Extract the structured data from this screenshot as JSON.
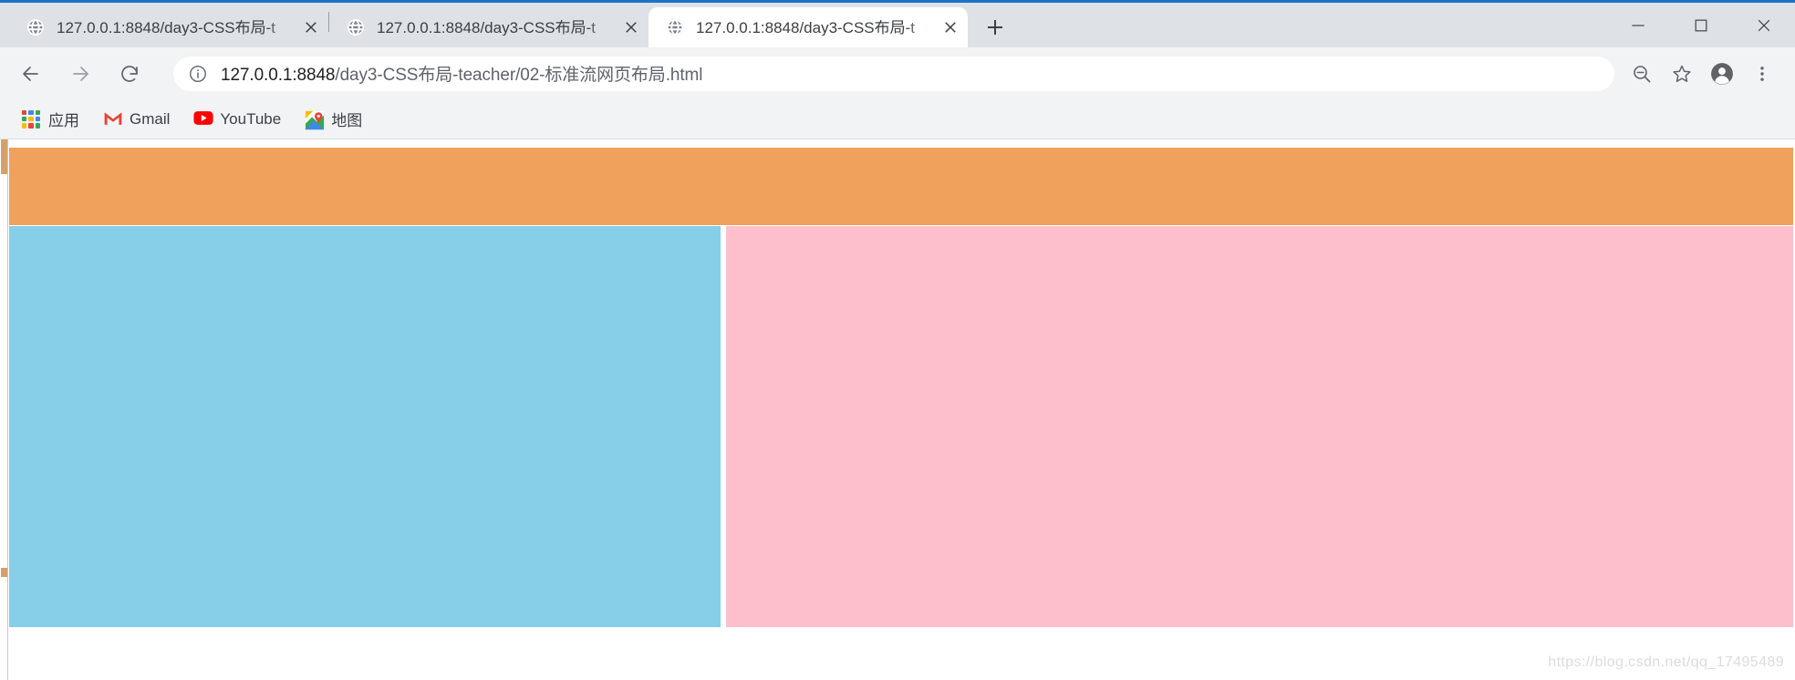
{
  "window": {
    "controls": {
      "minimize": "minimize-icon",
      "maximize": "maximize-icon",
      "close": "close-icon"
    }
  },
  "tabs": {
    "items": [
      {
        "title": "127.0.0.1:8848/day3-CSS布局-t",
        "favicon": "globe-icon",
        "active": false
      },
      {
        "title": "127.0.0.1:8848/day3-CSS布局-t",
        "favicon": "globe-icon",
        "active": false
      },
      {
        "title": "127.0.0.1:8848/day3-CSS布局-t",
        "favicon": "globe-icon",
        "active": true
      }
    ],
    "new_tab_label": "+"
  },
  "toolbar": {
    "back": "back-arrow-icon",
    "forward": "forward-arrow-icon",
    "reload": "reload-icon",
    "info": "info-circle-icon",
    "url_host": "127.0.0.1:8848",
    "url_path": "/day3-CSS布局-teacher/02-标准流网页布局.html",
    "url_full": "127.0.0.1:8848/day3-CSS布局-teacher/02-标准流网页布局.html",
    "zoom_out": "zoom-out-icon",
    "bookmark_star": "star-icon",
    "profile": "profile-avatar-icon",
    "menu": "three-dot-menu-icon"
  },
  "bookmarks": {
    "items": [
      {
        "label": "应用",
        "icon": "apps-grid-icon"
      },
      {
        "label": "Gmail",
        "icon": "gmail-icon"
      },
      {
        "label": "YouTube",
        "icon": "youtube-icon"
      },
      {
        "label": "地图",
        "icon": "google-maps-icon"
      }
    ]
  },
  "page": {
    "boxes": [
      {
        "name": "top-banner-box",
        "color": "#f0a15c"
      },
      {
        "name": "left-column-box",
        "color": "#87cee8"
      },
      {
        "name": "right-column-box",
        "color": "#febfcd"
      }
    ],
    "watermark": "https://blog.csdn.net/qq_17495489"
  },
  "colors": {
    "orange": "#f0a15c",
    "blue": "#87cee8",
    "pink": "#febfcd",
    "chrome_bar": "#dee1e6",
    "toolbar": "#f1f3f4",
    "accent_titlebar": "#1a73c7"
  }
}
